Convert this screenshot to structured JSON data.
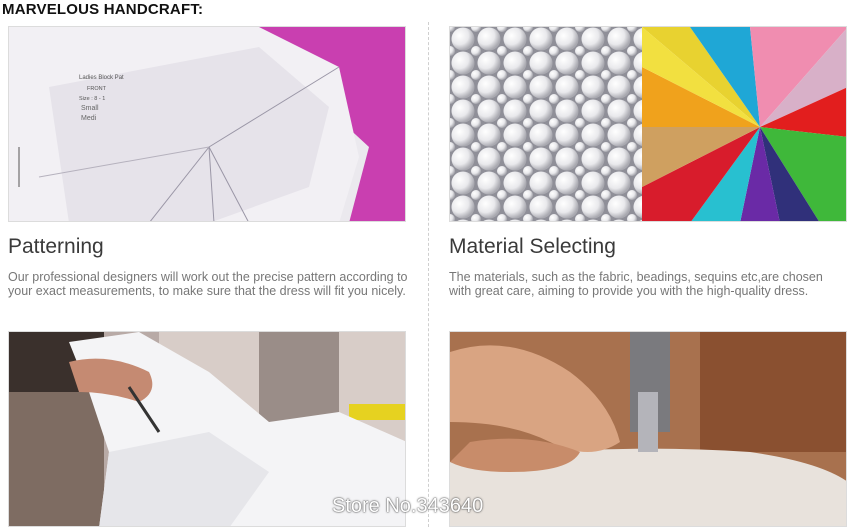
{
  "header": {
    "title": "MARVELOUS HANDCRAFT:"
  },
  "sections": [
    {
      "title": "Patterning",
      "description": "Our professional designers will work out the precise pattern according to your exact measurements, to make sure that the dress will fit you nicely."
    },
    {
      "title": "Material Selecting",
      "description": "The materials, such as the fabric, beadings, sequins etc,are chosen with great care, aiming to provide you with the high-quality dress."
    }
  ],
  "pattern_paper_text": [
    "Ladies Block Pat",
    "FRONT",
    "Size : 8 - 1",
    "Small",
    "Medi"
  ],
  "watermark": "Store No.343640"
}
